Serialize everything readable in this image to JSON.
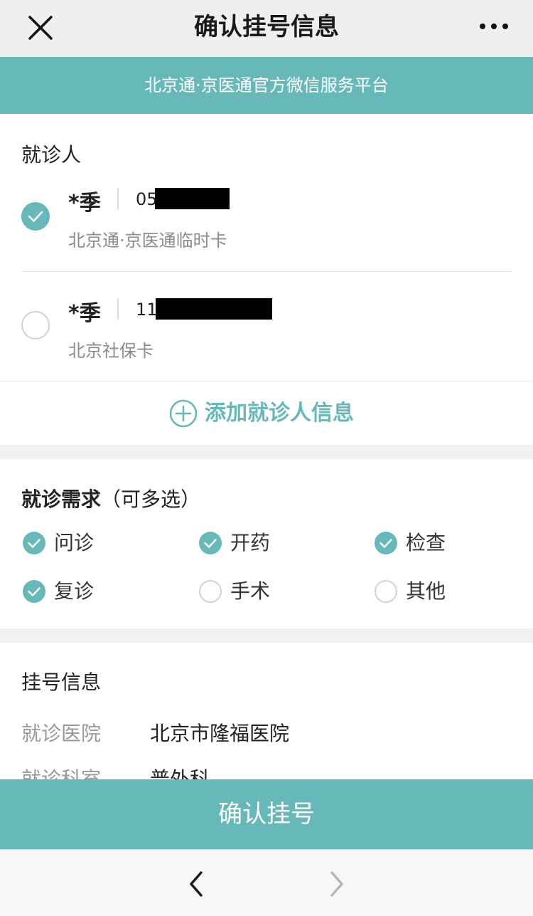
{
  "header": {
    "title": "确认挂号信息"
  },
  "banner": {
    "text": "北京通·京医通官方微信服务平台"
  },
  "patients": {
    "section_title": "就诊人",
    "items": [
      {
        "name": "*季",
        "id_prefix": "05",
        "card_type": "北京通·京医通临时卡",
        "selected": true
      },
      {
        "name": "*季",
        "id_prefix": "11",
        "card_type": "北京社保卡",
        "selected": false
      }
    ],
    "add_label": "添加就诊人信息"
  },
  "needs": {
    "title": "就诊需求",
    "hint": "（可多选）",
    "options": [
      {
        "label": "问诊",
        "checked": true
      },
      {
        "label": "开药",
        "checked": true
      },
      {
        "label": "检查",
        "checked": true
      },
      {
        "label": "复诊",
        "checked": true
      },
      {
        "label": "手术",
        "checked": false
      },
      {
        "label": "其他",
        "checked": false
      }
    ]
  },
  "registration": {
    "title": "挂号信息",
    "rows": [
      {
        "key": "就诊医院",
        "value": "北京市隆福医院"
      },
      {
        "key": "就诊科室",
        "value": "普外科"
      }
    ]
  },
  "confirm_label": "确认挂号",
  "colors": {
    "accent": "#67b9b9",
    "banner": "#67b9b9"
  },
  "icons": {
    "close": "close-icon",
    "more": "more-icon",
    "plus": "plus-circle-icon",
    "back": "chevron-left-icon",
    "forward": "chevron-right-icon"
  }
}
